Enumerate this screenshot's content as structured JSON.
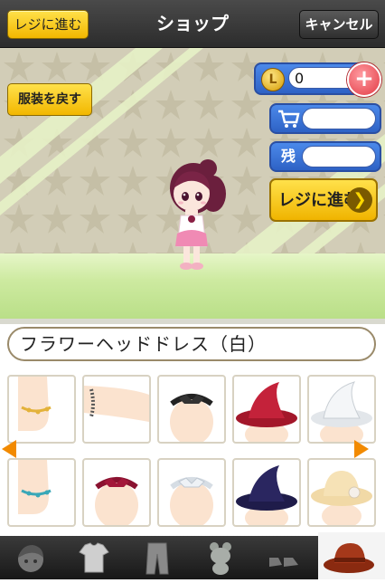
{
  "header": {
    "checkout_label": "レジに進む",
    "title": "ショップ",
    "cancel_label": "キャンセル"
  },
  "stage": {
    "revert_label": "服装を戻す",
    "coin_icon": "L",
    "coin_value": "0",
    "add_coin_icon": "+",
    "cart_value": "",
    "remaining_label": "残",
    "remaining_value": "",
    "checkout_big_label": "レジに進む",
    "checkout_arrow_icon": "chevron-right-icon"
  },
  "item": {
    "name": "フラワーヘッドドレス（白）"
  },
  "grid": {
    "items": [
      {
        "name": "gold-anklet"
      },
      {
        "name": "bead-bracelet"
      },
      {
        "name": "black-headband"
      },
      {
        "name": "red-witch-hat"
      },
      {
        "name": "white-witch-hat"
      },
      {
        "name": "teal-anklet"
      },
      {
        "name": "red-headband"
      },
      {
        "name": "white-headband"
      },
      {
        "name": "navy-witch-hat"
      },
      {
        "name": "straw-flower-hat"
      }
    ]
  },
  "tabs": [
    {
      "name": "face-tab",
      "icon": "face-icon"
    },
    {
      "name": "tops-tab",
      "icon": "shirt-icon"
    },
    {
      "name": "bottoms-tab",
      "icon": "pants-icon"
    },
    {
      "name": "accessory-tab",
      "icon": "plush-icon"
    },
    {
      "name": "shoes-tab",
      "icon": "shoes-icon"
    },
    {
      "name": "hats-tab",
      "icon": "hat-icon",
      "selected": true
    }
  ],
  "colors": {
    "accent_yellow": "#f2b700",
    "panel_blue": "#2e62c5",
    "add_red": "#e23b45",
    "arrow_orange": "#f28a00"
  }
}
